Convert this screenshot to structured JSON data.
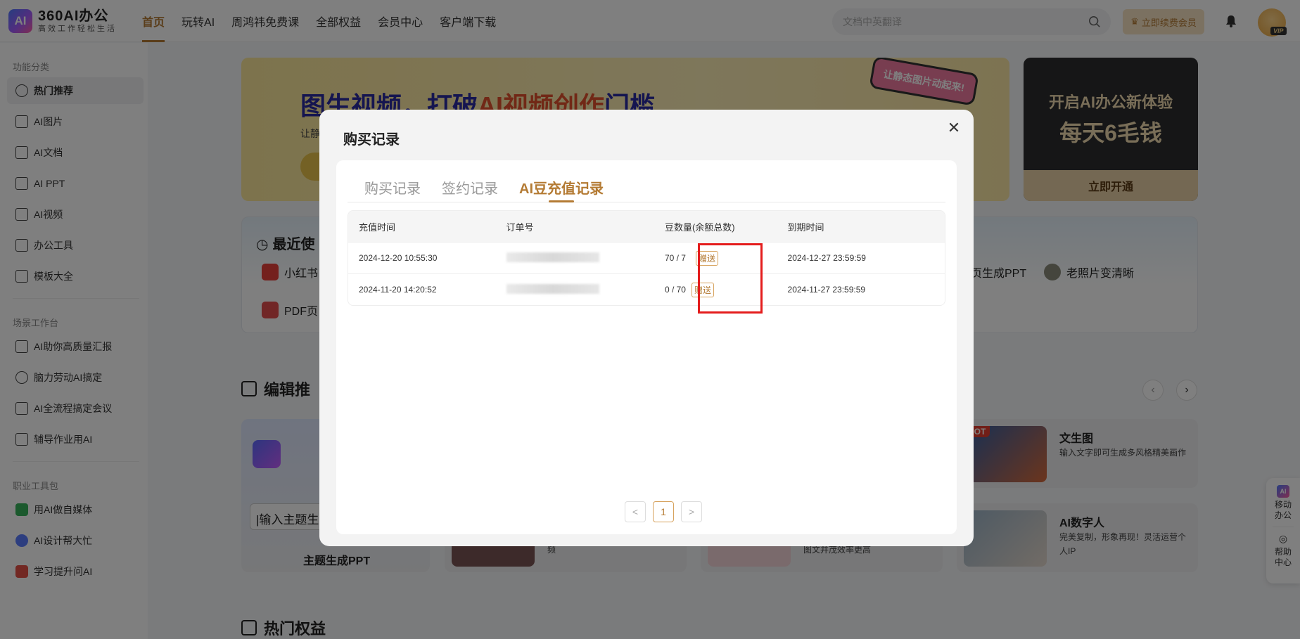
{
  "header": {
    "logo_badge": "AI",
    "logo_name": "360AI办公",
    "logo_slogan": "高效工作轻松生活",
    "nav": [
      "首页",
      "玩转AI",
      "周鸿祎免费课",
      "全部权益",
      "会员中心",
      "客户端下载"
    ],
    "search_placeholder": "文档中英翻译",
    "renew_label": "立即续费会员",
    "vip_label": "VIP"
  },
  "sidebar": {
    "group1": "功能分类",
    "items1": [
      "热门推荐",
      "AI图片",
      "AI文档",
      "AI PPT",
      "AI视频",
      "办公工具",
      "模板大全"
    ],
    "group2": "场景工作台",
    "items2": [
      "AI助你高质量汇报",
      "脑力劳动AI搞定",
      "AI全流程搞定会议",
      "辅导作业用AI"
    ],
    "group3": "职业工具包",
    "items3": [
      "用AI做自媒体",
      "AI设计帮大忙",
      "学习提升问AI"
    ]
  },
  "banner": {
    "title_a": "图生视频，打破",
    "title_b": "AI视频创作",
    "title_c": "门槛",
    "sub": "让静",
    "bubble": "让静态图片动起来!"
  },
  "promo": {
    "line1": "开启AI办公新体验",
    "line2": "每天6毛钱",
    "button": "立即开通"
  },
  "recent": {
    "title": "最近使",
    "items": [
      "小红书",
      "PDF页",
      "页生成PPT",
      "老照片变清晰"
    ]
  },
  "sections": {
    "editor_pick": "编辑推",
    "hot_benefits": "热门权益"
  },
  "cards": {
    "ppt_input": "|输入主题生",
    "ppt_title": "主题生成PPT",
    "card2_desc": "频",
    "card3_desc": "图文并茂效率更高",
    "wentu_title": "文生图",
    "wentu_desc": "输入文字即可生成多风格精美画作",
    "hot": "HOT",
    "digital_title": "AI数字人",
    "digital_desc": "完美复制，形象再现！灵活运营个人IP"
  },
  "float_panel": {
    "mobile": "移动办公",
    "help": "帮助中心"
  },
  "modal": {
    "title": "购买记录",
    "tabs": [
      "购买记录",
      "签约记录",
      "AI豆充值记录"
    ],
    "active_tab": 2,
    "columns": [
      "充值时间",
      "订单号",
      "豆数量(余额总数)",
      "到期时间"
    ],
    "rows": [
      {
        "time": "2024-12-20 10:55:30",
        "order": "",
        "amount": "70 / 7",
        "tag": "赠送",
        "expire": "2024-12-27 23:59:59"
      },
      {
        "time": "2024-11-20 14:20:52",
        "order": "",
        "amount": "0 / 70",
        "tag": "赠送",
        "expire": "2024-11-27 23:59:59"
      }
    ],
    "pager": {
      "prev": "<",
      "current": "1",
      "next": ">"
    }
  },
  "colors": {
    "accent": "#b47b34",
    "highlight_box": "#e41c1c",
    "overlay": "rgba(0,0,0,0.5)"
  }
}
